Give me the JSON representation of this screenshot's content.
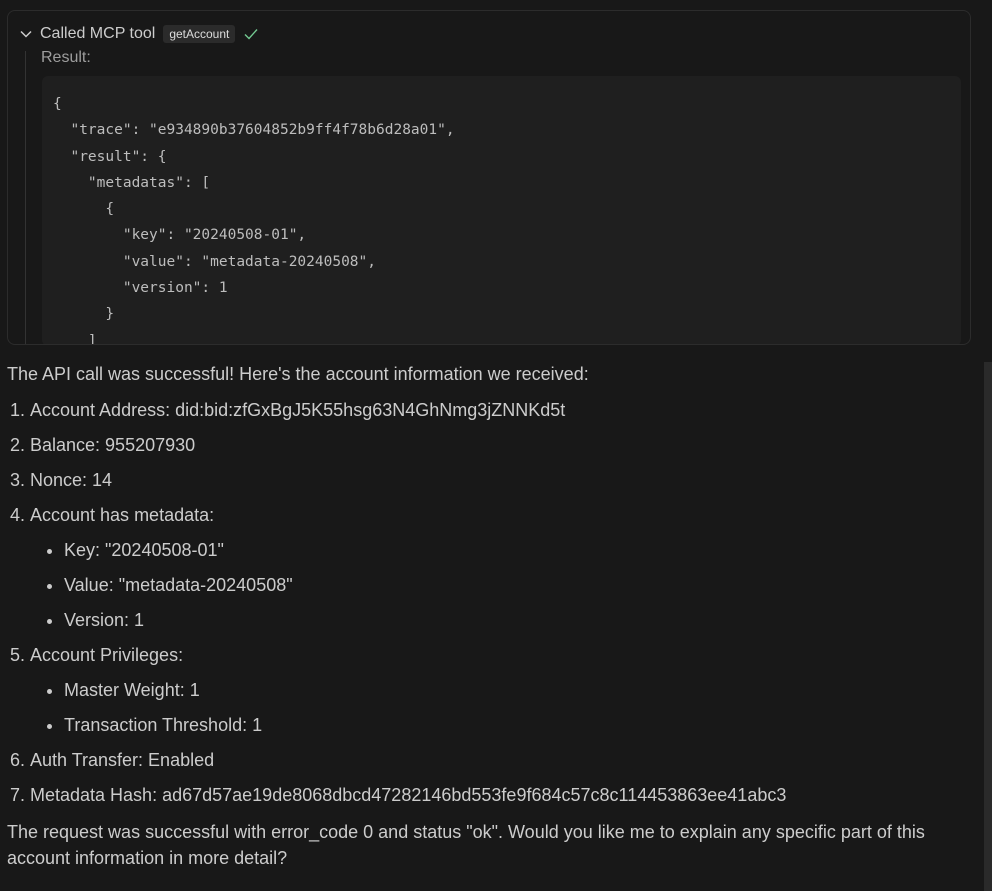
{
  "tool_call": {
    "title": "Called MCP tool",
    "tool_name": "getAccount",
    "result_label": "Result:",
    "code_lines": [
      "{",
      "  \"trace\": \"e934890b37604852b9ff4f78b6d28a01\",",
      "  \"result\": {",
      "    \"metadatas\": [",
      "      {",
      "        \"key\": \"20240508-01\",",
      "        \"value\": \"metadata-20240508\",",
      "        \"version\": 1",
      "      }",
      "    ]"
    ],
    "icons": {
      "collapse": "chevron-down-icon",
      "status": "checkmark-icon"
    },
    "status_color": "#73c991"
  },
  "response": {
    "intro": "The API call was successful! Here's the account information we received:",
    "items": [
      {
        "text": "Account Address: did:bid:zfGxBgJ5K55hsg63N4GhNmg3jZNNKd5t",
        "sub": []
      },
      {
        "text": "Balance: 955207930",
        "sub": []
      },
      {
        "text": "Nonce: 14",
        "sub": []
      },
      {
        "text": "Account has metadata:",
        "sub": [
          "Key: \"20240508-01\"",
          "Value: \"metadata-20240508\"",
          "Version: 1"
        ]
      },
      {
        "text": "Account Privileges:",
        "sub": [
          "Master Weight: 1",
          "Transaction Threshold: 1"
        ]
      },
      {
        "text": "Auth Transfer: Enabled",
        "sub": []
      },
      {
        "text": "Metadata Hash: ad67d57ae19de8068dbcd47282146bd553fe9f684c57c8c114453863ee41abc3",
        "sub": []
      }
    ],
    "outro": "The request was successful with error_code 0 and status \"ok\". Would you like me to explain any specific part of this account information in more detail?"
  }
}
